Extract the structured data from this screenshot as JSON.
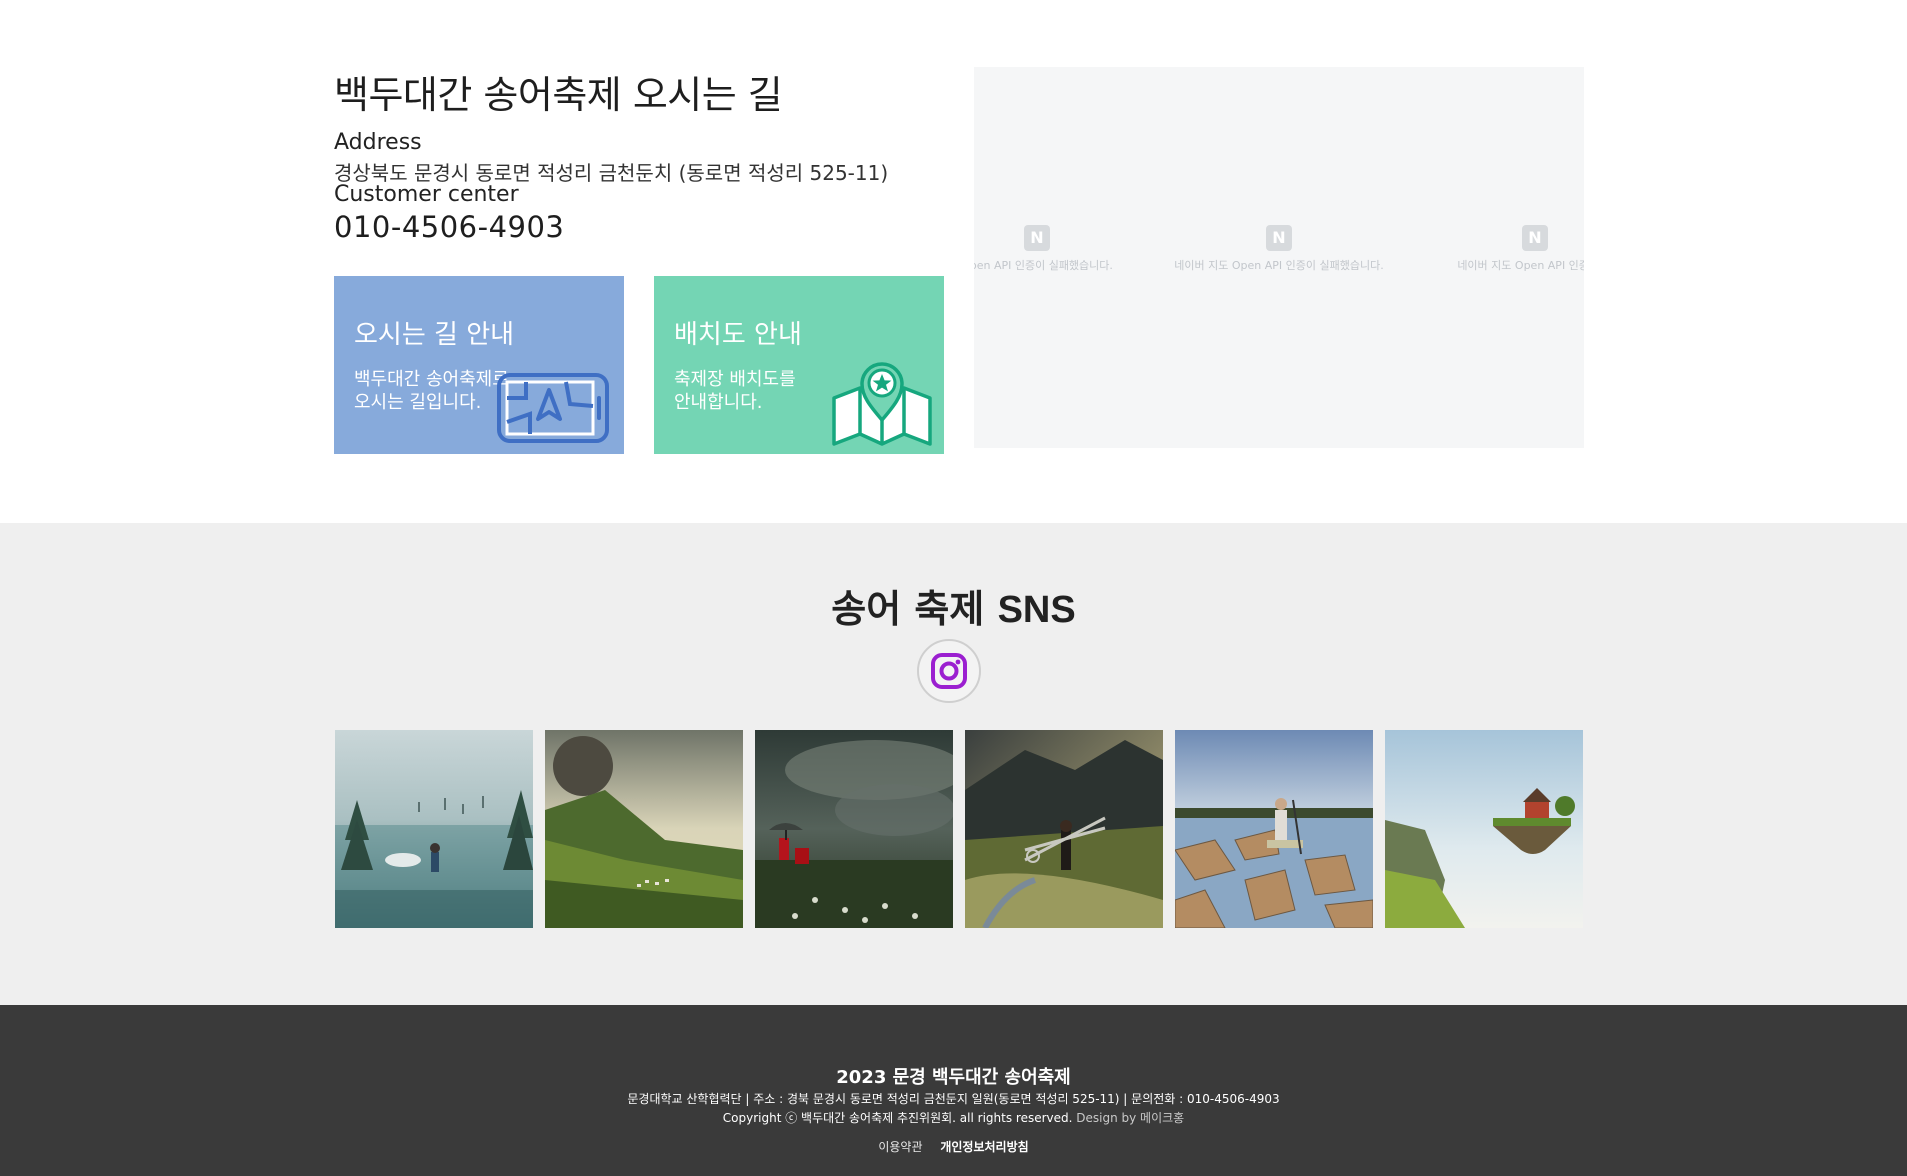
{
  "location": {
    "title": "백두대간 송어축제 오시는 길",
    "address_label": "Address",
    "address": "경상북도 문경시 동로면 적성리 금천둔치 (동로면 적성리 525-11)",
    "customer_center_label": "Customer center",
    "phone": "010-4506-4903",
    "cards": [
      {
        "title": "오시는 길 안내",
        "desc_line1": "백두대간 송어축제로",
        "desc_line2": "오시는 길입니다.",
        "icon": "navigation-phone-icon",
        "color": "#87aadb"
      },
      {
        "title": "배치도 안내",
        "desc_line1": "축제장 배치도를",
        "desc_line2": "안내합니다.",
        "icon": "map-pin-icon",
        "color": "#74d5b4"
      }
    ],
    "map": {
      "logo": "N",
      "tiles": [
        "Open API 인증이 실패했습니다.",
        "네이버 지도 Open API 인증이 실패했습니다.",
        "네이버 지도 Open API 인증이 실"
      ]
    }
  },
  "sns": {
    "title_main": "송어 축제 ",
    "title_bold": "SNS",
    "icon": "instagram-icon",
    "photos": [
      {
        "name": "flooded-forest-photo"
      },
      {
        "name": "valley-planet-photo"
      },
      {
        "name": "storm-umbrella-photo"
      },
      {
        "name": "mountain-scissors-photo"
      },
      {
        "name": "shattered-lake-photo"
      },
      {
        "name": "floating-island-photo"
      }
    ]
  },
  "footer": {
    "title": "2023 문경 백두대간 송어축제",
    "info": "문경대학교 산학협력단 | 주소 : 경북 문경시 동로면 적성리 금천둔지 일원(동로면 적성리 525-11) | 문의전화 : 010-4506-4903",
    "copyright": "Copyright ⓒ 백두대간 송어축제 추진위원회. all rights reserved. ",
    "design": "Design by 메이크홍",
    "links": [
      "이용약관",
      "개인정보처리방침"
    ]
  },
  "colors": {
    "card_blue": "#87aadb",
    "card_green": "#74d5b4",
    "sns_bg": "#efefef",
    "footer_bg": "#3a3a3a",
    "instagram": "#9b1fd0"
  }
}
